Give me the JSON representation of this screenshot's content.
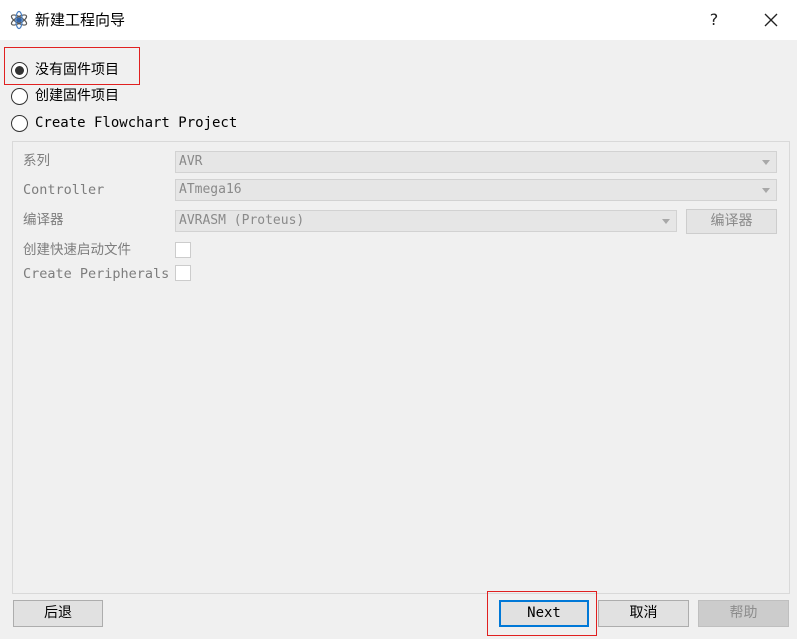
{
  "window": {
    "title": "新建工程向导",
    "help_symbol": "?",
    "app_icon": "atom-icon",
    "close_icon": "close-icon"
  },
  "options": [
    {
      "label": "没有固件项目",
      "checked": true
    },
    {
      "label": "创建固件项目",
      "checked": false
    },
    {
      "label": "Create Flowchart Project",
      "checked": false
    }
  ],
  "form": {
    "family_label": "系列",
    "family_value": "AVR",
    "controller_label": "Controller",
    "controller_value": "ATmega16",
    "compiler_label": "编译器",
    "compiler_value": "AVRASM (Proteus)",
    "compiler_button": "编译器",
    "quickstart_label": "创建快速启动文件",
    "quickstart_checked": false,
    "peripherals_label": "Create Peripherals",
    "peripherals_checked": false
  },
  "buttons": {
    "back": "后退",
    "next": "Next",
    "cancel": "取消",
    "help": "帮助"
  },
  "colors": {
    "highlight": "#e02020",
    "focus": "#0078d7"
  }
}
